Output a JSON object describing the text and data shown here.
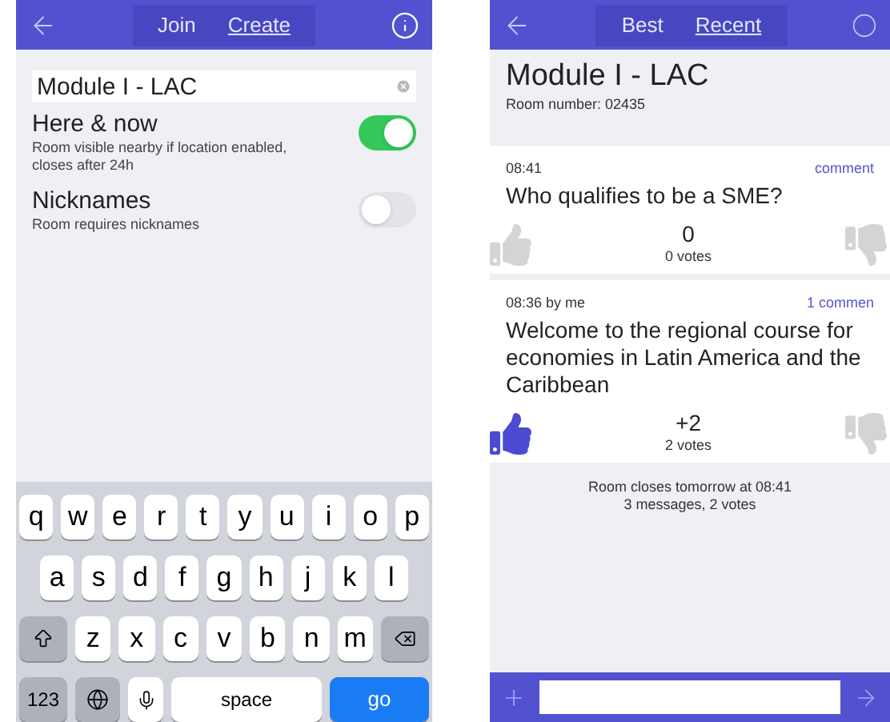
{
  "left_screen": {
    "nav": {
      "tabs": [
        {
          "label": "Join",
          "selected": false
        },
        {
          "label": "Create",
          "selected": true
        }
      ]
    },
    "name_field": {
      "value": "Module I - LAC"
    },
    "toggles": [
      {
        "title": "Here & now",
        "subtitle": "Room visible nearby if location enabled, closes after 24h",
        "on": true
      },
      {
        "title": "Nicknames",
        "subtitle": "Room requires nicknames",
        "on": false
      }
    ],
    "keyboard": {
      "key_rows": [
        {
          "keys": [
            {
              "kind": "letter",
              "label": "q"
            },
            {
              "kind": "letter",
              "label": "w"
            },
            {
              "kind": "letter",
              "label": "e"
            },
            {
              "kind": "letter",
              "label": "r"
            },
            {
              "kind": "letter",
              "label": "t"
            },
            {
              "kind": "letter",
              "label": "y"
            },
            {
              "kind": "letter",
              "label": "u"
            },
            {
              "kind": "letter",
              "label": "i"
            },
            {
              "kind": "letter",
              "label": "o"
            },
            {
              "kind": "letter",
              "label": "p"
            }
          ]
        },
        {
          "keys": [
            {
              "kind": "letter",
              "label": "a"
            },
            {
              "kind": "letter",
              "label": "s"
            },
            {
              "kind": "letter",
              "label": "d"
            },
            {
              "kind": "letter",
              "label": "f"
            },
            {
              "kind": "letter",
              "label": "g"
            },
            {
              "kind": "letter",
              "label": "h"
            },
            {
              "kind": "letter",
              "label": "j"
            },
            {
              "kind": "letter",
              "label": "k"
            },
            {
              "kind": "letter",
              "label": "l"
            }
          ]
        },
        {
          "keys": [
            {
              "kind": "shift"
            },
            {
              "kind": "letter",
              "label": "z"
            },
            {
              "kind": "letter",
              "label": "x"
            },
            {
              "kind": "letter",
              "label": "c"
            },
            {
              "kind": "letter",
              "label": "v"
            },
            {
              "kind": "letter",
              "label": "b"
            },
            {
              "kind": "letter",
              "label": "n"
            },
            {
              "kind": "letter",
              "label": "m"
            },
            {
              "kind": "backspace"
            }
          ]
        },
        {
          "keys": [
            {
              "kind": "numbers",
              "label": "123"
            },
            {
              "kind": "globe"
            },
            {
              "kind": "mic"
            },
            {
              "kind": "space",
              "label": "space"
            },
            {
              "kind": "go",
              "label": "go"
            }
          ]
        }
      ]
    }
  },
  "right_screen": {
    "nav": {
      "tabs": [
        {
          "label": "Best",
          "selected": false
        },
        {
          "label": "Recent",
          "selected": true
        }
      ]
    },
    "room": {
      "title": "Module I - LAC",
      "number": "Room number: 02435"
    },
    "messages": [
      {
        "meta": "08:41",
        "comments": "comment",
        "text": "Who qualifies to be a SME?",
        "score": "0",
        "votes": "0 votes",
        "upvoted": false
      },
      {
        "meta": "08:36 by me",
        "comments": "1 commen",
        "text": "Welcome to the regional course for economies in Latin America and the Caribbean",
        "score": "+2",
        "votes": "2 votes",
        "upvoted": true
      }
    ],
    "footer": {
      "lines": [
        "Room closes tomorrow at 08:41",
        "3 messages, 2 votes"
      ]
    }
  }
}
